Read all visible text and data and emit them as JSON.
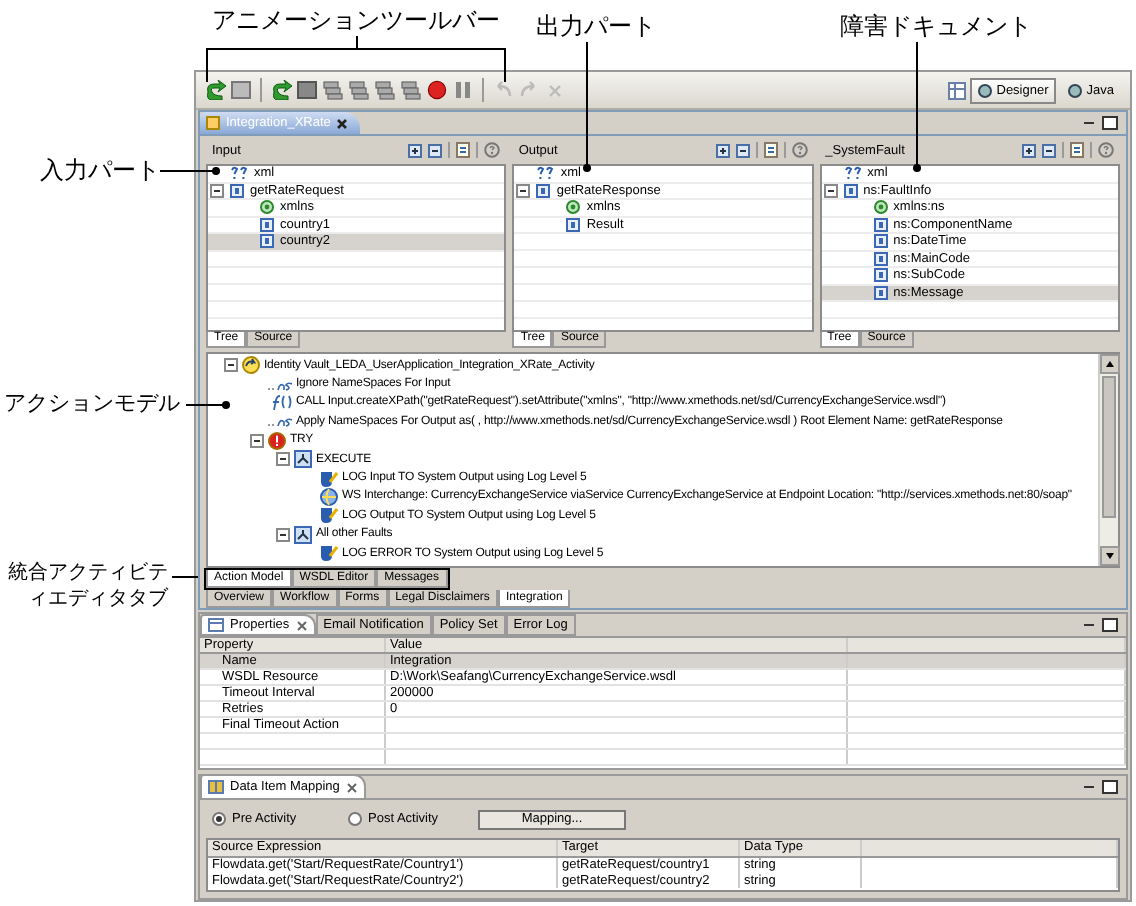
{
  "callouts": [
    {
      "text": "アニメーションツールバー"
    },
    {
      "text": "出力パート"
    },
    {
      "text": "障害ドキュメント"
    },
    {
      "text": "入力パート"
    },
    {
      "text": "アクションモデル"
    },
    {
      "text": "統合アクティビティエディタタブ"
    }
  ],
  "toolbar": {
    "perspectives": [
      {
        "label": "Designer",
        "selected": true
      },
      {
        "label": "Java",
        "selected": false
      }
    ]
  },
  "editor_tab": {
    "label": "Integration_XRate"
  },
  "panels": [
    {
      "title": "Input",
      "rows": [
        {
          "label": "xml",
          "kind": "xml",
          "selected": false
        },
        {
          "label": "getRateRequest",
          "kind": "element",
          "selected": false,
          "expanded": true,
          "children": [
            {
              "label": "xmlns",
              "kind": "namespace",
              "selected": false
            },
            {
              "label": "country1",
              "kind": "element",
              "selected": false
            },
            {
              "label": "country2",
              "kind": "element",
              "selected": true
            }
          ]
        }
      ],
      "tabs": [
        {
          "label": "Tree",
          "selected": true
        },
        {
          "label": "Source",
          "selected": false
        }
      ]
    },
    {
      "title": "Output",
      "rows": [
        {
          "label": "xml",
          "kind": "xml",
          "selected": false
        },
        {
          "label": "getRateResponse",
          "kind": "element",
          "selected": false,
          "expanded": true,
          "children": [
            {
              "label": "xmlns",
              "kind": "namespace",
              "selected": false
            },
            {
              "label": "Result",
              "kind": "element",
              "selected": false
            }
          ]
        }
      ],
      "tabs": [
        {
          "label": "Tree",
          "selected": true
        },
        {
          "label": "Source",
          "selected": false
        }
      ]
    },
    {
      "title": "_SystemFault",
      "rows": [
        {
          "label": "xml",
          "kind": "xml",
          "selected": false
        },
        {
          "label": "ns:FaultInfo",
          "kind": "element",
          "selected": false,
          "expanded": true,
          "children": [
            {
              "label": "xmlns:ns",
              "kind": "namespace",
              "selected": false
            },
            {
              "label": "ns:ComponentName",
              "kind": "element",
              "selected": false
            },
            {
              "label": "ns:DateTime",
              "kind": "element",
              "selected": false
            },
            {
              "label": "ns:MainCode",
              "kind": "element",
              "selected": false
            },
            {
              "label": "ns:SubCode",
              "kind": "element",
              "selected": false
            },
            {
              "label": "ns:Message",
              "kind": "element",
              "selected": true
            }
          ]
        }
      ],
      "tabs": [
        {
          "label": "Tree",
          "selected": true
        },
        {
          "label": "Source",
          "selected": false
        }
      ]
    }
  ],
  "action_model": {
    "rows": [
      {
        "label": "Identity Vault_LEDA_UserApplication_Integration_XRate_Activity",
        "kind": "identity",
        "expanded": true,
        "children": [
          {
            "label": "Ignore NameSpaces For  Input",
            "kind": "ns"
          },
          {
            "label": "CALL  Input.createXPath(\"getRateRequest\").setAttribute(\"xmlns\", \"http://www.xmethods.net/sd/CurrencyExchangeService.wsdl\")",
            "kind": "fx"
          },
          {
            "label": "Apply NameSpaces For  Output  as( , http://www.xmethods.net/sd/CurrencyExchangeService.wsdl )  Root Element Name: getRateResponse",
            "kind": "ns"
          },
          {
            "label": "TRY",
            "kind": "try",
            "expanded": true,
            "children": [
              {
                "label": "EXECUTE",
                "kind": "block",
                "expanded": true,
                "children": [
                  {
                    "label": "LOG Input TO System Output using Log Level 5",
                    "kind": "log"
                  },
                  {
                    "label": "WS Interchange: CurrencyExchangeService viaService CurrencyExchangeService at Endpoint Location: \"http://services.xmethods.net:80/soap\"",
                    "kind": "ws"
                  },
                  {
                    "label": "LOG Output TO System Output using Log Level 5",
                    "kind": "log"
                  }
                ]
              },
              {
                "label": "All other Faults",
                "kind": "block",
                "expanded": true,
                "children": [
                  {
                    "label": "LOG ERROR TO System Output using Log Level 5",
                    "kind": "log"
                  }
                ]
              }
            ]
          }
        ]
      }
    ]
  },
  "editor_tabs": [
    {
      "label": "Action Model",
      "selected": true
    },
    {
      "label": "WSDL Editor",
      "selected": false
    },
    {
      "label": "Messages",
      "selected": false
    }
  ],
  "page_tabs": [
    {
      "label": "Overview",
      "selected": false
    },
    {
      "label": "Workflow",
      "selected": false
    },
    {
      "label": "Forms",
      "selected": false
    },
    {
      "label": "Legal Disclaimers",
      "selected": false
    },
    {
      "label": "Integration",
      "selected": true
    }
  ],
  "properties_view": {
    "tabs": [
      {
        "label": "Properties",
        "selected": true
      },
      {
        "label": "Email Notification",
        "selected": false
      },
      {
        "label": "Policy Set",
        "selected": false
      },
      {
        "label": "Error Log",
        "selected": false
      }
    ],
    "columns": [
      "Property",
      "Value"
    ],
    "rows": [
      {
        "property": "Name",
        "value": "Integration",
        "selected": true
      },
      {
        "property": "WSDL Resource",
        "value": "D:\\Work\\Seafang\\CurrencyExchangeService.wsdl",
        "selected": false
      },
      {
        "property": "Timeout Interval",
        "value": "200000",
        "selected": false
      },
      {
        "property": "Retries",
        "value": "0",
        "selected": false
      },
      {
        "property": "Final Timeout Action",
        "selected": false
      }
    ]
  },
  "data_mapping": {
    "title": "Data Item Mapping",
    "options": [
      {
        "label": "Pre Activity",
        "selected": true
      },
      {
        "label": "Post Activity",
        "selected": false
      }
    ],
    "button": "Mapping...",
    "columns": [
      "Source Expression",
      "Target",
      "Data Type"
    ],
    "rows": [
      {
        "source": "Flowdata.get('Start/RequestRate/Country1')",
        "target": "getRateRequest/country1",
        "type": "string"
      },
      {
        "source": "Flowdata.get('Start/RequestRate/Country2')",
        "target": "getRateRequest/country2",
        "type": "string"
      }
    ]
  }
}
